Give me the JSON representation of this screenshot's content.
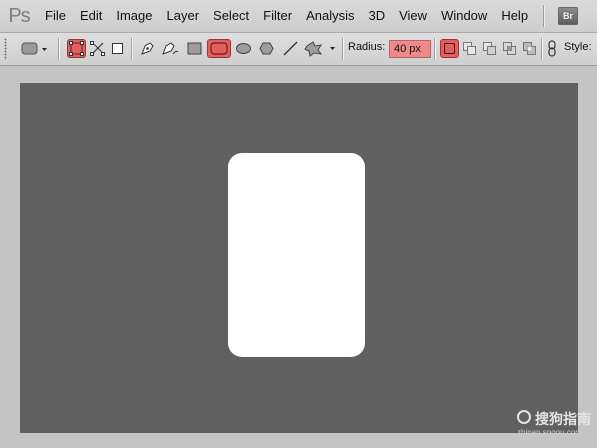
{
  "app": {
    "logo": "Ps"
  },
  "menu": [
    "File",
    "Edit",
    "Image",
    "Layer",
    "Select",
    "Filter",
    "Analysis",
    "3D",
    "View",
    "Window",
    "Help"
  ],
  "bridge_button": "Br",
  "options": {
    "radius_label": "Radius:",
    "radius_value": "40 px",
    "style_label": "Style:"
  },
  "watermark": {
    "main": "搜狗指南",
    "sub": "zhinan.sogou.com"
  },
  "colors": {
    "active_tool": "#e35f5f",
    "radius_field": "#f08a8a",
    "document_bg": "#606060",
    "shape_fill": "#ffffff",
    "workspace_bg": "#c4c4c4"
  }
}
